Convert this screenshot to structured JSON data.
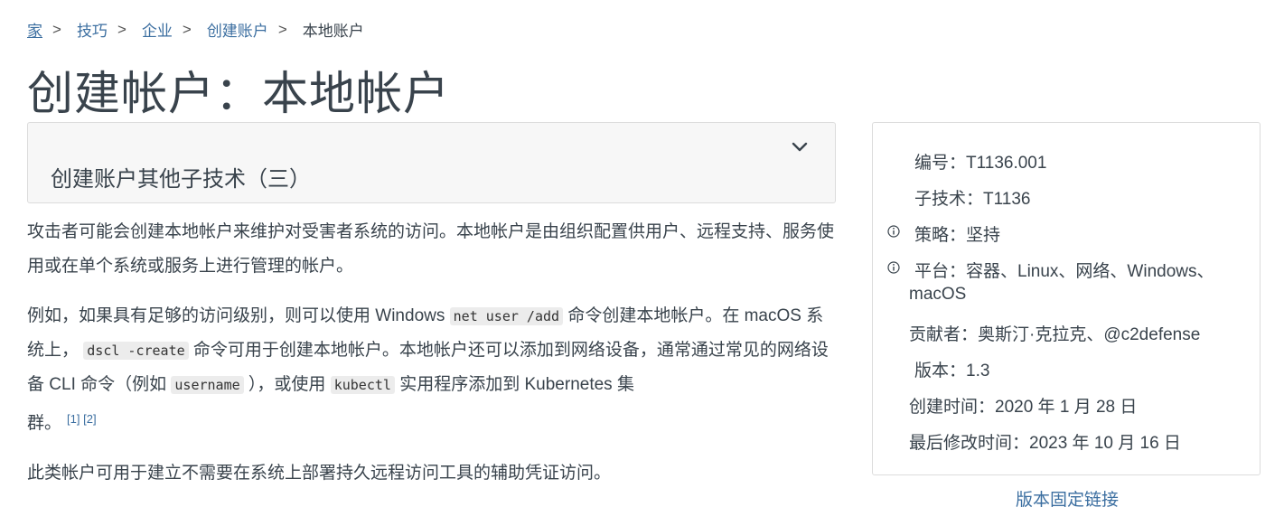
{
  "breadcrumb": {
    "items": [
      "家",
      "技巧",
      "企业",
      "创建账户"
    ],
    "separator": ">",
    "current": "本地账户"
  },
  "page_title": "创建帐户：本地帐户",
  "subtechniques": {
    "title": "创建账户其他子技术（三）",
    "icon": "chevron-down-icon"
  },
  "description": {
    "p1": "攻击者可能会创建本地帐户来维护对受害者系统的访问。本地帐户是由组织配置供用户、远程支持、服务使用或在单个系统或服务上进行管理的帐户。",
    "p2": {
      "t1": "例如，如果具有足够的访问级别，则可以使用 Windows ",
      "code1": "net user /add",
      "t2": " 命令创建本地帐户。在 macOS 系统上， ",
      "code2": "dscl -create",
      "t3": " 命令可用于创建本地帐户。本地帐户还可以添加到网络设备，通常通过常见的网络设备 CLI 命令（例如 ",
      "code3": "username",
      "t4": " ），或使用 ",
      "code4": "kubectl",
      "t5": " 实用程序添加到 Kubernetes 集",
      "t6": "群。",
      "refs": [
        "[1]",
        "[2]"
      ]
    },
    "p3": "此类帐户可用于建立不需要在系统上部署持久远程访问工具的辅助凭证访问。"
  },
  "info": {
    "id": "编号：T1136.001",
    "subtechnique_of": "子技术：T1136",
    "tactic": "策略：坚持",
    "platforms_line1": "平台：容器、Linux、网络、Windows、",
    "platforms_line2": "macOS",
    "contributors": "贡献者：奥斯汀·克拉克、@c2defense",
    "version": "版本：1.3",
    "created": "创建时间：2020 年 1 月 28 日",
    "last_modified": "最后修改时间：2023 年 10 月 16 日",
    "info_icon": "info-circle-icon"
  },
  "permalink": "版本固定链接"
}
